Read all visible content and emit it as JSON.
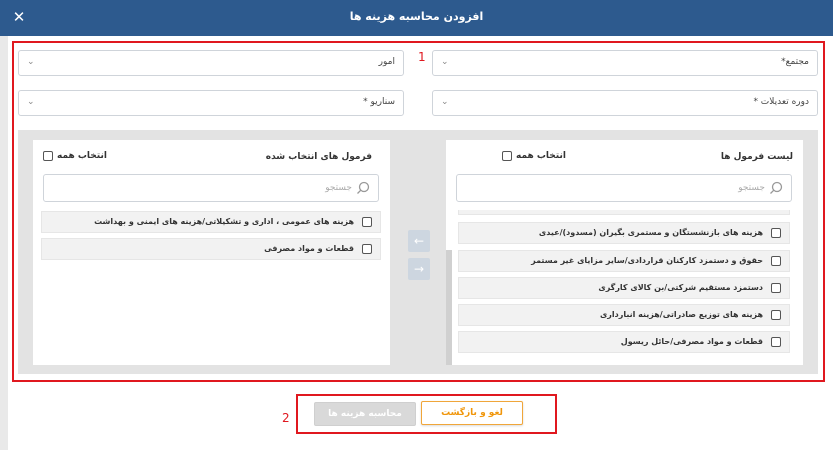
{
  "dialog": {
    "title": "افزودن محاسبه هزینه ها",
    "close_icon": "close-icon"
  },
  "annotations": {
    "box1": "1",
    "box2": "2"
  },
  "fields": {
    "complex": "مجتمع*",
    "affairs": "امور",
    "adjustment_period": "دوره تعدیلات *",
    "scenario": "سناریو *"
  },
  "formula_list": {
    "title": "لیست فرمول ها",
    "select_all": "انتخاب همه",
    "search_placeholder": "جستجو",
    "items": [
      "هزینه های بازنشستگان و مستمری بگیران (مسدود)/عیدی",
      "حقوق و دستمزد کارکنان قراردادی/سایر مزایای غیر مستمر",
      "دستمزد مستقیم شرکتی/بن کالای کارگری",
      "هزینه های توزیع صادراتی/هزینه انبارداری",
      "قطعات و مواد مصرفی/حائل ریسول"
    ]
  },
  "selected_formulas": {
    "title": "فرمول های انتخاب شده",
    "select_all": "انتخاب همه",
    "search_placeholder": "جستجو",
    "items": [
      "هزینه های عمومی ، اداری و تشکیلاتی/هزینه های ایمنی و بهداشت",
      "قطعات و مواد مصرفی"
    ]
  },
  "buttons": {
    "calculate": "محاسبه هزینه ها",
    "cancel": "لغو و بازگشت"
  },
  "colors": {
    "header": "#2d5a8e",
    "annotation_red": "#e0181f",
    "cancel_orange": "#f0960b"
  }
}
